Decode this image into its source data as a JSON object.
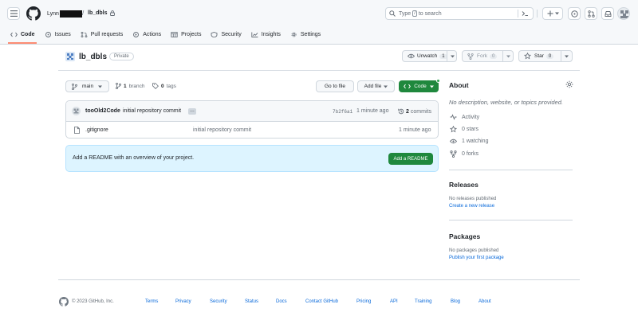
{
  "header": {
    "owner": "Lynn",
    "separator": "/",
    "repo": "lb_dbls",
    "search": {
      "prefix": "Type",
      "key": "/",
      "suffix": "to search"
    }
  },
  "nav": [
    {
      "label": "Code",
      "icon": "code-icon",
      "active": true
    },
    {
      "label": "Issues",
      "icon": "issue-icon"
    },
    {
      "label": "Pull requests",
      "icon": "pull-request-icon"
    },
    {
      "label": "Actions",
      "icon": "play-icon"
    },
    {
      "label": "Projects",
      "icon": "table-icon"
    },
    {
      "label": "Security",
      "icon": "shield-icon"
    },
    {
      "label": "Insights",
      "icon": "graph-icon"
    },
    {
      "label": "Settings",
      "icon": "gear-icon"
    }
  ],
  "repo": {
    "name": "lb_dbls",
    "visibility": "Private",
    "unwatch_label": "Unwatch",
    "watch_count": "1",
    "fork_label": "Fork",
    "fork_count": "0",
    "star_label": "Star",
    "star_count": "0"
  },
  "toolbar": {
    "branch": "main",
    "branches_count": "1",
    "branches_label": "branch",
    "tags_count": "0",
    "tags_label": "tags",
    "goto_file": "Go to file",
    "add_file": "Add file",
    "code": "Code"
  },
  "commit": {
    "author": "tooOld2Code",
    "message": "initial repository commit",
    "ellipsis": "…",
    "sha": "7b2f6a1",
    "time": "1 minute ago",
    "commits_count": "2",
    "commits_label": "commits"
  },
  "files": [
    {
      "name": ".gitignore",
      "message": "initial repository commit",
      "time": "1 minute ago"
    }
  ],
  "readme": {
    "text": "Add a README with an overview of your project.",
    "button": "Add a README"
  },
  "about": {
    "title": "About",
    "description": "No description, website, or topics provided.",
    "activity": "Activity",
    "stars": "0 stars",
    "watching": "1 watching",
    "forks": "0 forks"
  },
  "releases": {
    "title": "Releases",
    "text": "No releases published",
    "link": "Create a new release"
  },
  "packages": {
    "title": "Packages",
    "text": "No packages published",
    "link": "Publish your first package"
  },
  "footer": {
    "copyright": "© 2023 GitHub, Inc.",
    "links": [
      "Terms",
      "Privacy",
      "Security",
      "Status",
      "Docs",
      "Contact GitHub",
      "Pricing",
      "API",
      "Training",
      "Blog",
      "About"
    ]
  },
  "colors": {
    "accent_link": "#0969da",
    "primary_button": "#1f883d",
    "active_tab_underline": "#fd8c73",
    "readme_bg": "#ddf4ff"
  }
}
